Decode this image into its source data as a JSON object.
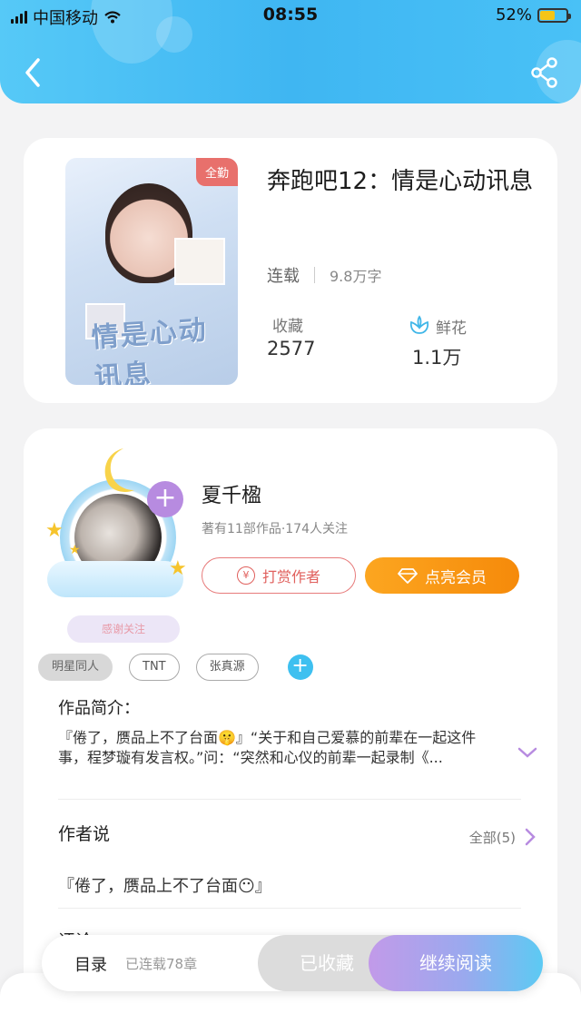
{
  "status_bar": {
    "carrier": "中国移动",
    "time": "08:55",
    "battery": "52%"
  },
  "book": {
    "badge": "全勤",
    "title": "奔跑吧12：情是心动讯息",
    "status": "连载",
    "words": "9.8万字",
    "collect_label": "收藏",
    "collect_value": "2577",
    "flower_label": "鲜花",
    "flower_value": "1.1万",
    "cover_text": "情是心动讯息"
  },
  "author": {
    "name": "夏千楹",
    "meta": "著有11部作品·174人关注",
    "reward_label": "打赏作者",
    "vip_label": "点亮会员",
    "thanks_label": "感谢关注",
    "plus": "+"
  },
  "tags": [
    "明星同人",
    "TNT",
    "张真源"
  ],
  "intro": {
    "title": "作品简介：",
    "text": "『倦了，赝品上不了台面🤫』“关于和自己爱慕的前辈在一起这件事，程梦璇有发言权。”问：“突然和心仪的前辈一起录制《..."
  },
  "author_says": {
    "title": "作者说",
    "all_label": "全部(5)",
    "text": "『倦了，赝品上不了台面😶』"
  },
  "comments": {
    "title": "评论"
  },
  "bottom_bar": {
    "toc_label": "目录",
    "chapters": "已连载78章",
    "collected_label": "已收藏",
    "read_label": "继续阅读"
  },
  "colors": {
    "header": "#47bff5",
    "accent_purple": "#b78be0",
    "reward_red": "#e0605d",
    "vip_orange": "#f68a0a"
  }
}
